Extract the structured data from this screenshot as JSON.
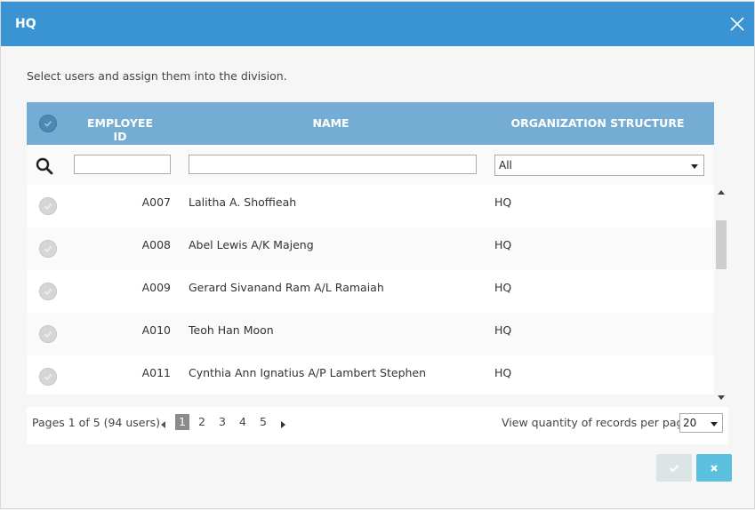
{
  "dialog": {
    "title": "HQ",
    "instruction": "Select users and assign them into the division."
  },
  "grid": {
    "columns": {
      "employee_id": "EMPLOYEE ID",
      "name": "NAME",
      "org_structure": "ORGANIZATION STRUCTURE"
    },
    "filters": {
      "employee_id_value": "",
      "name_value": "",
      "org_selected": "All"
    },
    "rows": [
      {
        "id": "A007",
        "name": "Lalitha A. Shoffieah",
        "org": "HQ"
      },
      {
        "id": "A008",
        "name": "Abel Lewis A/K Majeng",
        "org": "HQ"
      },
      {
        "id": "A009",
        "name": "Gerard Sivanand Ram A/L Ramaiah",
        "org": "HQ"
      },
      {
        "id": "A010",
        "name": "Teoh Han Moon",
        "org": "HQ"
      },
      {
        "id": "A011",
        "name": "Cynthia Ann Ignatius A/P Lambert Stephen",
        "org": "HQ"
      }
    ]
  },
  "pager": {
    "info": "Pages 1 of 5 (94 users)",
    "pages": [
      "1",
      "2",
      "3",
      "4",
      "5"
    ],
    "current_page": "1",
    "rpp_label": "View quantity of records per page",
    "rpp_value": "20"
  },
  "icons": {
    "close": "close-icon",
    "search": "search-icon",
    "check": "check-icon",
    "cancel": "x-icon"
  },
  "colors": {
    "titlebar": "#3a94d3",
    "header": "#75acd4",
    "cancel_button": "#5bc0de",
    "ok_button_disabled": "#dde4e6"
  }
}
